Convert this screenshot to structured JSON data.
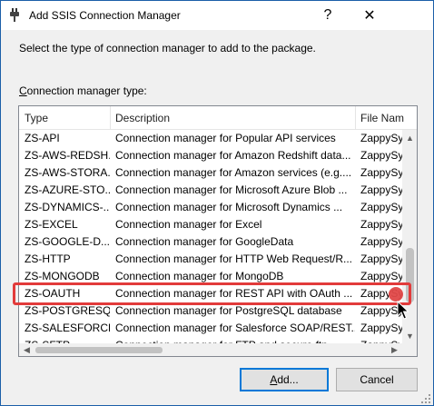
{
  "window": {
    "title": "Add SSIS Connection Manager",
    "help_glyph": "?",
    "close_glyph": "✕"
  },
  "instruction": "Select the type of connection manager to add to the package.",
  "list_label_prefix": "C",
  "list_label_rest": "onnection manager type:",
  "columns": {
    "type": "Type",
    "description": "Description",
    "file_name": "File Nam"
  },
  "rows": [
    {
      "type": "ZS-API",
      "description": "Connection manager for Popular API services",
      "file": "ZappySy"
    },
    {
      "type": "ZS-AWS-REDSH...",
      "description": "Connection manager for Amazon Redshift data...",
      "file": "ZappySy"
    },
    {
      "type": "ZS-AWS-STORA...",
      "description": "Connection manager for Amazon services (e.g....",
      "file": "ZappySy"
    },
    {
      "type": "ZS-AZURE-STO...",
      "description": "Connection manager for Microsoft Azure Blob ...",
      "file": "ZappySy"
    },
    {
      "type": "ZS-DYNAMICS-...",
      "description": "Connection manager for Microsoft Dynamics ...",
      "file": "ZappySy"
    },
    {
      "type": "ZS-EXCEL",
      "description": "Connection manager for Excel",
      "file": "ZappySy"
    },
    {
      "type": "ZS-GOOGLE-D...",
      "description": "Connection manager for GoogleData",
      "file": "ZappySy"
    },
    {
      "type": "ZS-HTTP",
      "description": "Connection manager for HTTP Web Request/R...",
      "file": "ZappySy"
    },
    {
      "type": "ZS-MONGODB",
      "description": "Connection manager for MongoDB",
      "file": "ZappySy"
    },
    {
      "type": "ZS-OAUTH",
      "description": "Connection manager for REST API with OAuth ...",
      "file": "ZappySy"
    },
    {
      "type": "ZS-POSTGRESQL",
      "description": "Connection manager for PostgreSQL database",
      "file": "ZappySy"
    },
    {
      "type": "ZS-SALESFORCE",
      "description": "Connection manager for Salesforce SOAP/REST...",
      "file": "ZappySy"
    },
    {
      "type": "ZS-SFTP",
      "description": "Connection manager for FTP and secure ftp...",
      "file": "ZappySy"
    }
  ],
  "selected_row": "ZS-OAUTH",
  "buttons": {
    "add_prefix": "A",
    "add_rest": "dd...",
    "cancel": "Cancel"
  },
  "colors": {
    "highlight": "#e23b3b",
    "window_border": "#1c5fa8",
    "default_button_border": "#0078d7"
  }
}
